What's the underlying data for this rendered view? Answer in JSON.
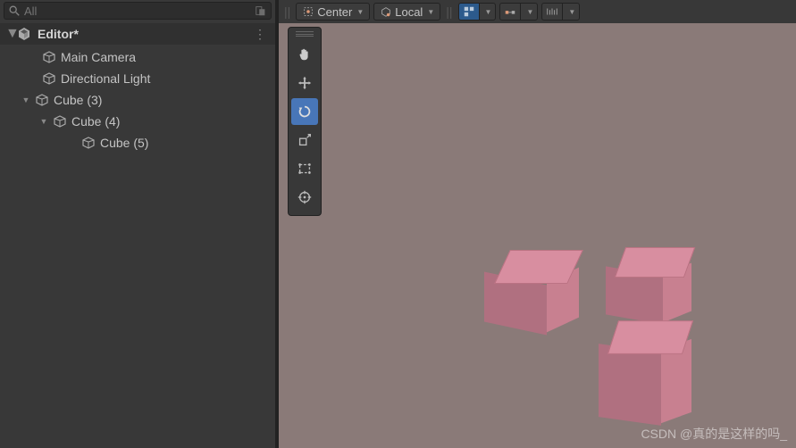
{
  "search": {
    "placeholder": "All"
  },
  "scene": {
    "title": "Editor*"
  },
  "hierarchy": [
    {
      "label": "Main Camera",
      "indent": 1,
      "expandable": false
    },
    {
      "label": "Directional Light",
      "indent": 1,
      "expandable": false
    },
    {
      "label": "Cube (3)",
      "indent": 1,
      "expandable": true,
      "expanded": true
    },
    {
      "label": "Cube (4)",
      "indent": 2,
      "expandable": true,
      "expanded": true
    },
    {
      "label": "Cube (5)",
      "indent": 3,
      "expandable": false
    }
  ],
  "toolbar": {
    "pivot": "Center",
    "space": "Local"
  },
  "tools": {
    "active": "rotate"
  },
  "watermark": "CSDN @真的是这样的吗_"
}
